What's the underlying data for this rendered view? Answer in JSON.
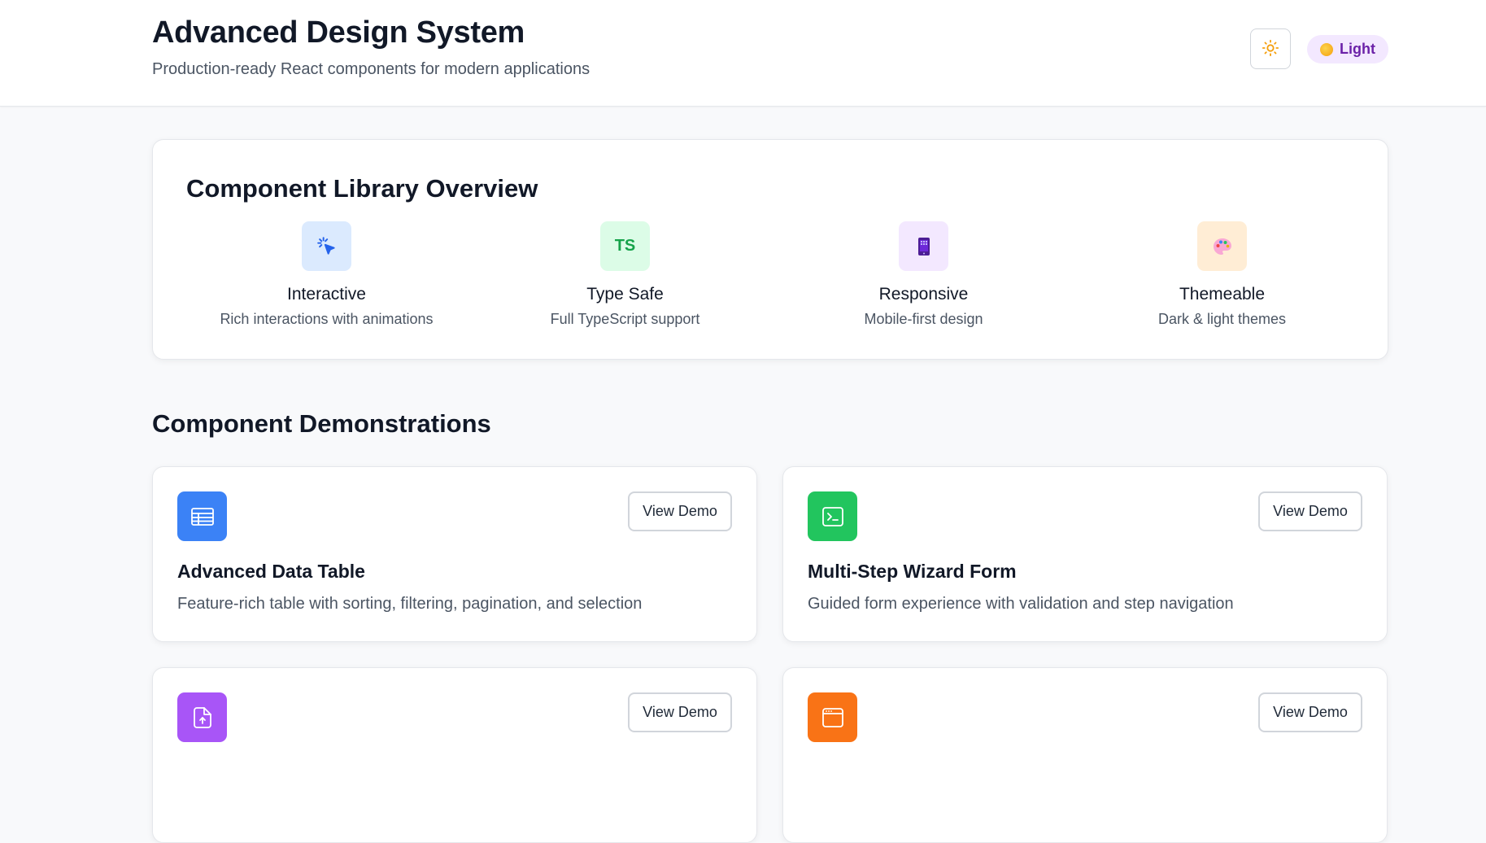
{
  "header": {
    "title": "Advanced Design System",
    "subtitle": "Production-ready React components for modern applications",
    "theme_badge_label": "Light"
  },
  "overview": {
    "title": "Component Library Overview",
    "features": [
      {
        "title": "Interactive",
        "desc": "Rich interactions with animations",
        "icon": "cursor-click-icon",
        "badge": ""
      },
      {
        "title": "Type Safe",
        "desc": "Full TypeScript support",
        "icon": "typescript-icon",
        "badge": "TS"
      },
      {
        "title": "Responsive",
        "desc": "Mobile-first design",
        "icon": "mobile-phone-icon",
        "badge": ""
      },
      {
        "title": "Themeable",
        "desc": "Dark & light themes",
        "icon": "palette-icon",
        "badge": ""
      }
    ]
  },
  "demos": {
    "title": "Component Demonstrations",
    "cards": [
      {
        "title": "Advanced Data Table",
        "desc": "Feature-rich table with sorting, filtering, pagination, and selection",
        "button": "View Demo",
        "icon": "table-icon",
        "color": "#3b82f6"
      },
      {
        "title": "Multi-Step Wizard Form",
        "desc": "Guided form experience with validation and step navigation",
        "button": "View Demo",
        "icon": "terminal-icon",
        "color": "#22c55e"
      },
      {
        "title": "",
        "desc": "",
        "button": "View Demo",
        "icon": "file-upload-icon",
        "color": "#a855f7"
      },
      {
        "title": "",
        "desc": "",
        "button": "View Demo",
        "icon": "browser-window-icon",
        "color": "#f97316"
      }
    ]
  },
  "colors": {
    "brand_purple_bg": "#f3e8ff",
    "brand_purple_text": "#6b21a8",
    "feature_blue_bg": "#dbeafe",
    "feature_green_bg": "#dcfce7",
    "feature_purple_bg": "#f3e8ff",
    "feature_orange_bg": "#ffedd5"
  }
}
